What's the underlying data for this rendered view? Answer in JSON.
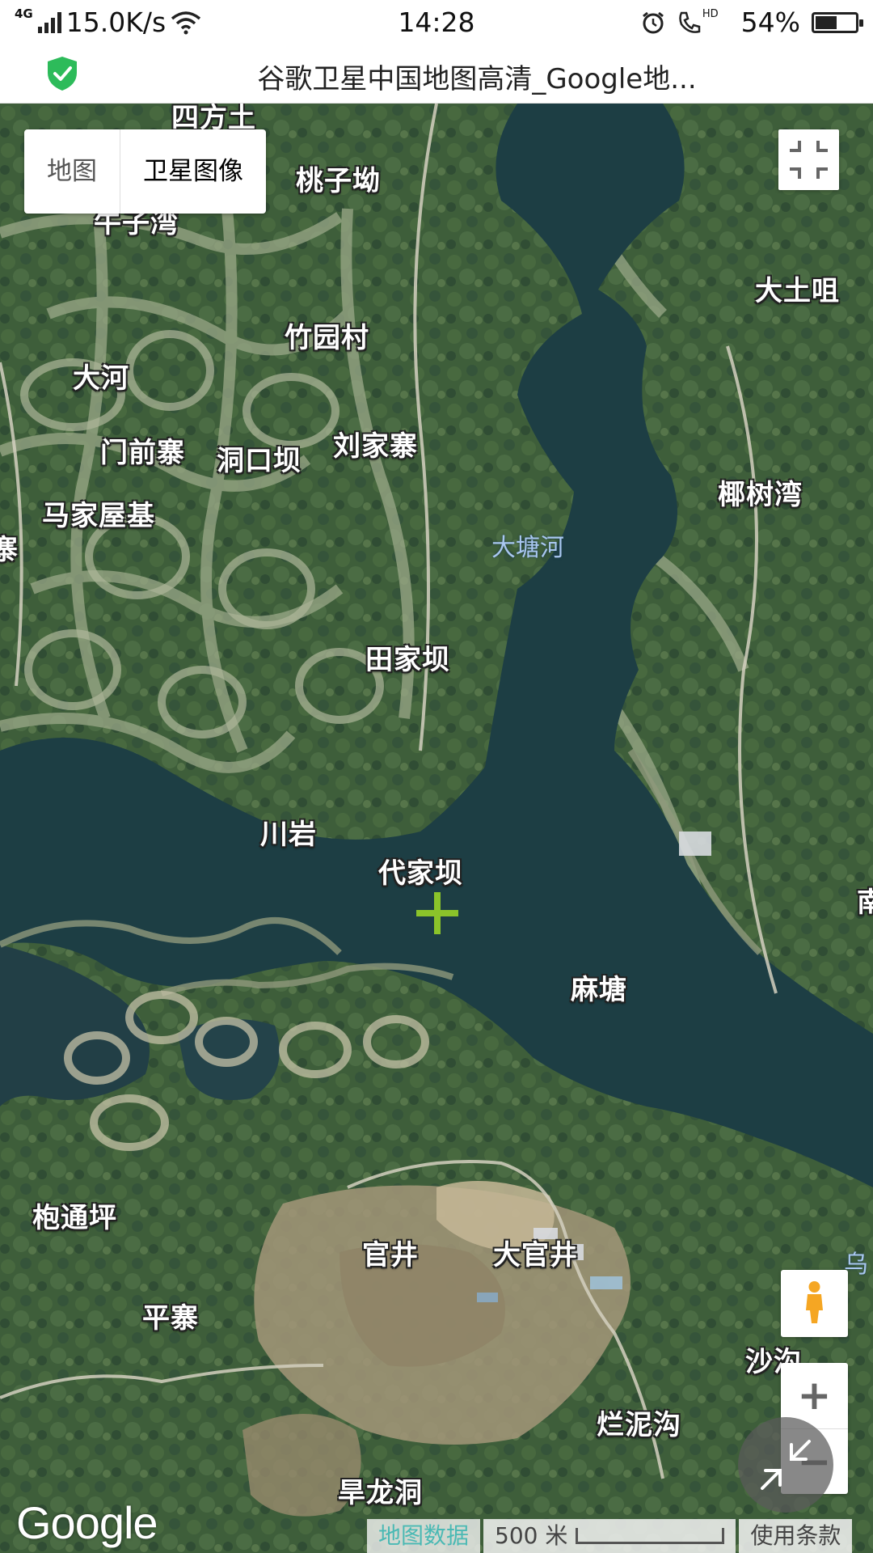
{
  "status_bar": {
    "network": "4G",
    "speed": "15.0K/s",
    "time": "14:28",
    "hd": "HD",
    "battery": "54%",
    "battery_level": 0.54
  },
  "title_bar": {
    "title": "谷歌卫星中国地图高清_Google地..."
  },
  "map": {
    "type_control": {
      "map": "地图",
      "satellite": "卫星图像"
    },
    "labels": {
      "sifangtu": "四方土",
      "taoziao": "桃子坳",
      "niuziwan": "牛子湾",
      "datuju": "大土咀",
      "zhuyuancun": "竹园村",
      "dahe": "大河",
      "menqianzhai": "门前寨",
      "dongkouba": "洞口坝",
      "liujiazhai": "刘家寨",
      "majiawuji": "马家屋基",
      "yeshuwan": "椰树湾",
      "edge_zhai": "寨",
      "tianjiaba": "田家坝",
      "chuanyan": "川岩",
      "daijiaba": "代家坝",
      "edge_nan": "南",
      "matang": "麻塘",
      "paotongping": "枹通坪",
      "guanjing": "官井",
      "daguanjing": "大官井",
      "edge_wu": "乌",
      "pingzhai": "平寨",
      "shagou": "沙沟",
      "lannigou": "烂泥沟",
      "hanlongdong": "旱龙洞"
    },
    "water_labels": {
      "datanghe": "大塘河"
    },
    "logo": "Google",
    "attribution": {
      "map_data": "地图数据",
      "scale": "500 米",
      "terms": "使用条款"
    }
  }
}
